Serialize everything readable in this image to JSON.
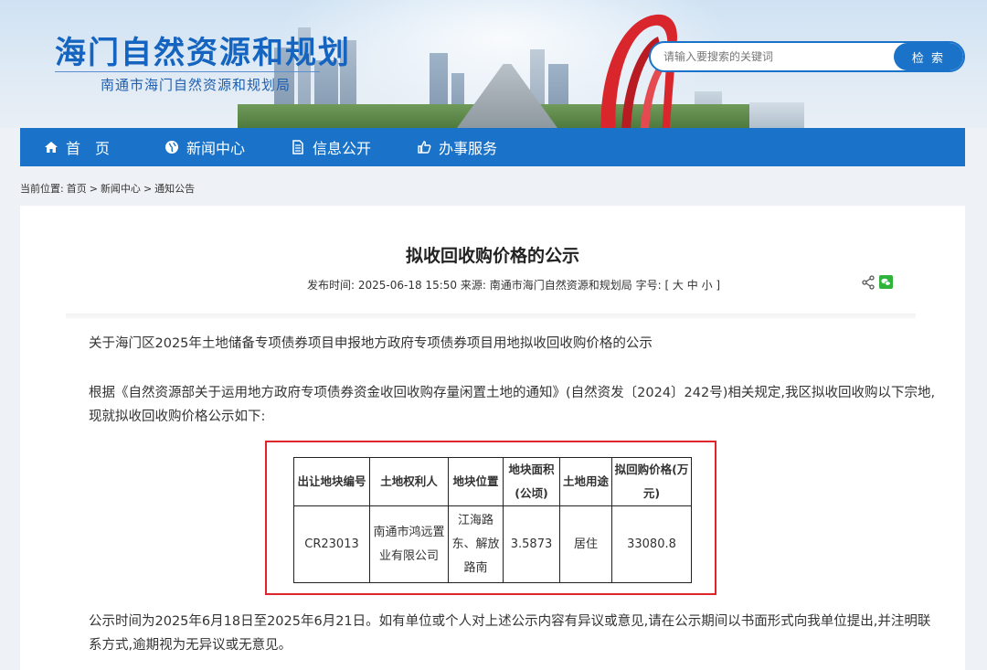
{
  "header": {
    "site_title": "海门自然资源和规划",
    "site_subtitle": "南通市海门自然资源和规划局",
    "search_placeholder": "请输入要搜索的关键词",
    "search_button": "检 索"
  },
  "nav": {
    "items": [
      {
        "label": "首　页",
        "icon": "home-icon"
      },
      {
        "label": "新闻中心",
        "icon": "globe-icon"
      },
      {
        "label": "信息公开",
        "icon": "document-icon"
      },
      {
        "label": "办事服务",
        "icon": "thumbs-up-icon"
      }
    ]
  },
  "breadcrumb": {
    "prefix": "当前位置:",
    "items": [
      "首页",
      "新闻中心",
      "通知公告"
    ],
    "sep": ">"
  },
  "article": {
    "title": "拟收回收购价格的公示",
    "meta_publish_label": "发布时间:",
    "meta_publish": "2025-06-18 15:50",
    "meta_source_label": "来源:",
    "meta_source": "南通市海门自然资源和规划局",
    "meta_fontsize_label": "字号:",
    "meta_fontsize": "[ 大 中 小 ]",
    "para1": "关于海门区2025年土地储备专项债券项目申报地方政府专项债券项目用地拟收回收购价格的公示",
    "para2": "根据《自然资源部关于运用地方政府专项债券资金收回收购存量闲置土地的通知》(自然资发〔2024〕242号)相关规定,我区拟收回收购以下宗地,现就拟收回收购价格公示如下:",
    "para3": "公示时间为2025年6月18日至2025年6月21日。如有单位或个人对上述公示内容有异议或意见,请在公示期间以书面形式向我单位提出,并注明联系方式,逾期视为无异议或无意见。",
    "table": {
      "headers": [
        "出让地块编号",
        "土地权利人",
        "地块位置",
        "地块面积(公顷)",
        "土地用途",
        "拟回购价格(万元)"
      ],
      "rows": [
        [
          "CR23013",
          "南通市鸿远置业有限公司",
          "江海路东、解放路南",
          "3.5873",
          "居住",
          "33080.8"
        ]
      ]
    }
  },
  "colors": {
    "brand_blue": "#1a73c8",
    "highlight_red": "#e0242b"
  }
}
